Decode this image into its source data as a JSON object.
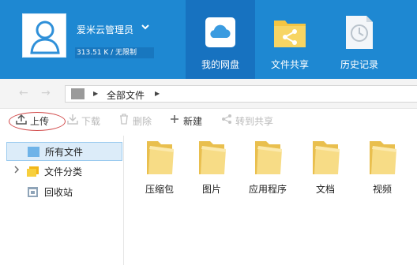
{
  "user": {
    "name": "爱米云管理员",
    "quota": "313.51 K / 无限制"
  },
  "nav": {
    "tabs": [
      {
        "label": "我的网盘",
        "icon": "cloud-icon",
        "active": true
      },
      {
        "label": "文件共享",
        "icon": "share-folder-icon",
        "active": false
      },
      {
        "label": "历史记录",
        "icon": "clock-document-icon",
        "active": false
      }
    ]
  },
  "path": {
    "current": "全部文件"
  },
  "toolbar": {
    "upload": "上传",
    "download": "下载",
    "delete": "删除",
    "new": "新建",
    "move_to_share": "转到共享"
  },
  "sidebar": {
    "items": [
      {
        "label": "所有文件",
        "icon": "folder-icon",
        "selected": true
      },
      {
        "label": "文件分类",
        "icon": "category-icon",
        "expandable": true
      },
      {
        "label": "回收站",
        "icon": "recycle-bin-icon"
      }
    ]
  },
  "files": [
    {
      "name": "压缩包"
    },
    {
      "name": "图片"
    },
    {
      "name": "应用程序"
    },
    {
      "name": "文档"
    },
    {
      "name": "视频"
    }
  ],
  "colors": {
    "header": "#1e88d2",
    "active_tab": "#1772c0",
    "folder": "#f6d77a",
    "selection": "#dcecf9"
  }
}
